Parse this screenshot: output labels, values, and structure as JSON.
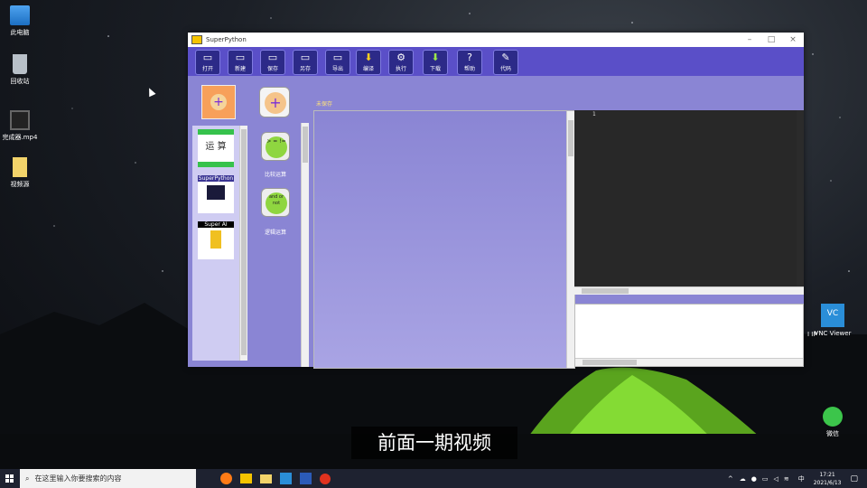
{
  "desktop": {
    "icons": [
      {
        "label": "此电脑"
      },
      {
        "label": "回收站"
      },
      {
        "label": "完成器.mp4"
      },
      {
        "label": "视频源"
      }
    ],
    "right_icons": [
      {
        "label": "VNC Viewer"
      },
      {
        "label": "微信"
      }
    ],
    "partial_text": "I IP"
  },
  "window": {
    "title": "SuperPython",
    "controls": {
      "minimize": "–",
      "maximize": "□",
      "close": "×"
    }
  },
  "toolbar": {
    "buttons": [
      {
        "label": "打开",
        "icon": "folder-open-icon",
        "glyph": "▭"
      },
      {
        "label": "新建",
        "icon": "new-file-icon",
        "glyph": "▭"
      },
      {
        "label": "保存",
        "icon": "save-icon",
        "glyph": "▭"
      },
      {
        "label": "另存",
        "icon": "save-as-icon",
        "glyph": "▭"
      },
      {
        "label": "导出",
        "icon": "export-icon",
        "glyph": "▭"
      },
      {
        "label": "编译",
        "icon": "compile-arrow-icon",
        "glyph": "⬇"
      },
      {
        "label": "执行",
        "icon": "gear-icon",
        "glyph": "⚙"
      },
      {
        "label": "下载",
        "icon": "download-icon",
        "glyph": "⬇"
      },
      {
        "label": "帮助",
        "icon": "help-icon",
        "glyph": "?"
      },
      {
        "label": "代码",
        "icon": "code-edit-icon",
        "glyph": "✎"
      }
    ]
  },
  "palette": {
    "categories": [
      {
        "label": "运 算"
      },
      {
        "label": "SuperPython"
      },
      {
        "label": "Super AI"
      }
    ],
    "blocks": [
      {
        "label": "比较运算",
        "text": "> = !="
      },
      {
        "label": "逻辑运算",
        "text": "and or not"
      }
    ]
  },
  "canvas": {
    "status_label": "未保存"
  },
  "editor": {
    "line_number": "1"
  },
  "subtitle": "前面一期视频",
  "taskbar": {
    "search_placeholder": "在这里输入你要搜索的内容",
    "ime": "中",
    "time": "17:21",
    "date": "2021/6/13"
  },
  "colors": {
    "window_bg": "#8a85d4",
    "toolbar_bg": "#5a4fc8",
    "editor_bg": "#282828",
    "block_green": "#8fd640",
    "block_plus": "#f5c48a"
  }
}
